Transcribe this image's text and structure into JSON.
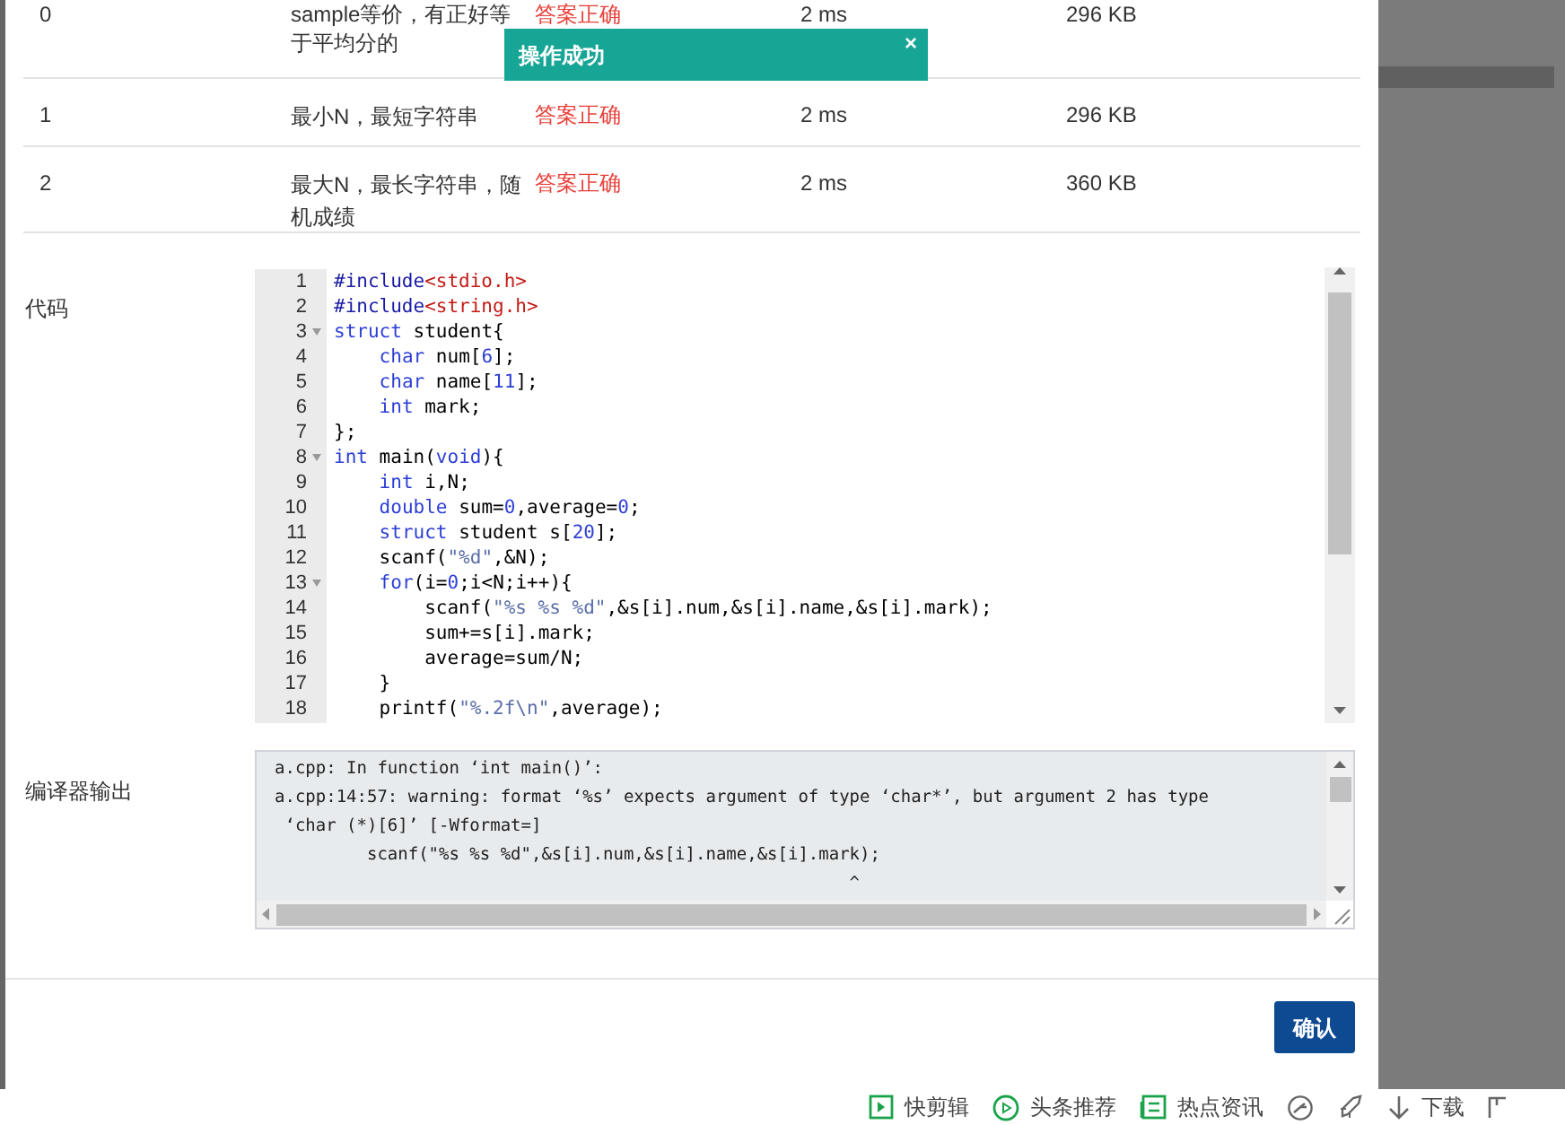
{
  "toast": {
    "message": "操作成功",
    "close": "×"
  },
  "results": [
    {
      "index": "0",
      "case": [
        "sample等价，有正好等",
        "于平均分的"
      ],
      "status": "答案正确",
      "time": "2 ms",
      "memory": "296 KB"
    },
    {
      "index": "1",
      "case": "最小N，最短字符串",
      "status": "答案正确",
      "time": "2 ms",
      "memory": "296 KB"
    },
    {
      "index": "2",
      "case": "最大N，最长字符串，随机成绩",
      "status": "答案正确",
      "time": "2 ms",
      "memory": "360 KB"
    }
  ],
  "code": {
    "label": "代码",
    "lines": [
      {
        "number": "1",
        "text": "#include<stdio.h>",
        "fold": false
      },
      {
        "number": "2",
        "text": "#include<string.h>",
        "fold": false
      },
      {
        "number": "3",
        "text": "struct student{",
        "fold": true
      },
      {
        "number": "4",
        "text": "    char num[6];",
        "fold": false
      },
      {
        "number": "5",
        "text": "    char name[11];",
        "fold": false
      },
      {
        "number": "6",
        "text": "    int mark;",
        "fold": false
      },
      {
        "number": "7",
        "text": "};",
        "fold": false
      },
      {
        "number": "8",
        "text": "int main(void){",
        "fold": true
      },
      {
        "number": "9",
        "text": "    int i,N;",
        "fold": false
      },
      {
        "number": "10",
        "text": "    double sum=0,average=0;",
        "fold": false
      },
      {
        "number": "11",
        "text": "    struct student s[20];",
        "fold": false
      },
      {
        "number": "12",
        "text": "    scanf(\"%d\",&N);",
        "fold": false
      },
      {
        "number": "13",
        "text": "    for(i=0;i<N;i++){",
        "fold": true
      },
      {
        "number": "14",
        "text": "        scanf(\"%s %s %d\",&s[i].num,&s[i].name,&s[i].mark);",
        "fold": false
      },
      {
        "number": "15",
        "text": "        sum+=s[i].mark;",
        "fold": false
      },
      {
        "number": "16",
        "text": "        average=sum/N;",
        "fold": false
      },
      {
        "number": "17",
        "text": "    }",
        "fold": false
      },
      {
        "number": "18",
        "text": "    printf(\"%.2f\\n\",average);",
        "fold": false
      }
    ]
  },
  "compiler": {
    "label": "编译器输出",
    "lines": [
      "a.cpp: In function ‘int main()’:",
      "a.cpp:14:57: warning: format ‘%s’ expects argument of type ‘char*’, but argument 2 has type",
      " ‘char (*)[6]’ [-Wformat=]",
      "         scanf(\"%s %s %d\",&s[i].num,&s[i].name,&s[i].mark);",
      "                                                        ^"
    ]
  },
  "confirm_button": "确认",
  "taskbar": [
    {
      "kind": "clip",
      "label": "快剪辑"
    },
    {
      "kind": "play",
      "label": "头条推荐"
    },
    {
      "kind": "news",
      "label": "热点资讯"
    },
    {
      "kind": "speed"
    },
    {
      "kind": "rocket"
    },
    {
      "kind": "download",
      "label": "下载"
    },
    {
      "kind": "window"
    }
  ]
}
